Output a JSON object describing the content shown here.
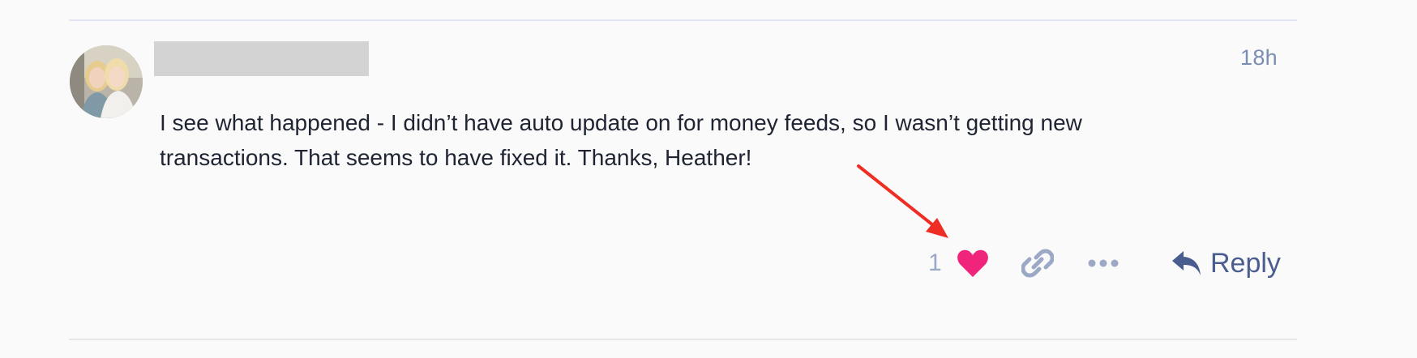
{
  "post": {
    "timestamp": "18h",
    "body": "I see what happened - I didn’t have auto update on for money feeds, so I wasn’t getting new transactions. That seems to have fixed it. Thanks, Heather!",
    "actions": {
      "like_count": "1",
      "reply_label": "Reply"
    }
  },
  "icons": {
    "heart": "heart-icon",
    "link": "link-icon",
    "more": "more-icon",
    "reply": "reply-arrow-icon"
  },
  "colors": {
    "heart": "#f0247a",
    "muted_icon": "#9ba8c6",
    "reply": "#4a5d8f",
    "annotation_arrow": "#ee2d24",
    "timestamp": "#7a8db4"
  }
}
